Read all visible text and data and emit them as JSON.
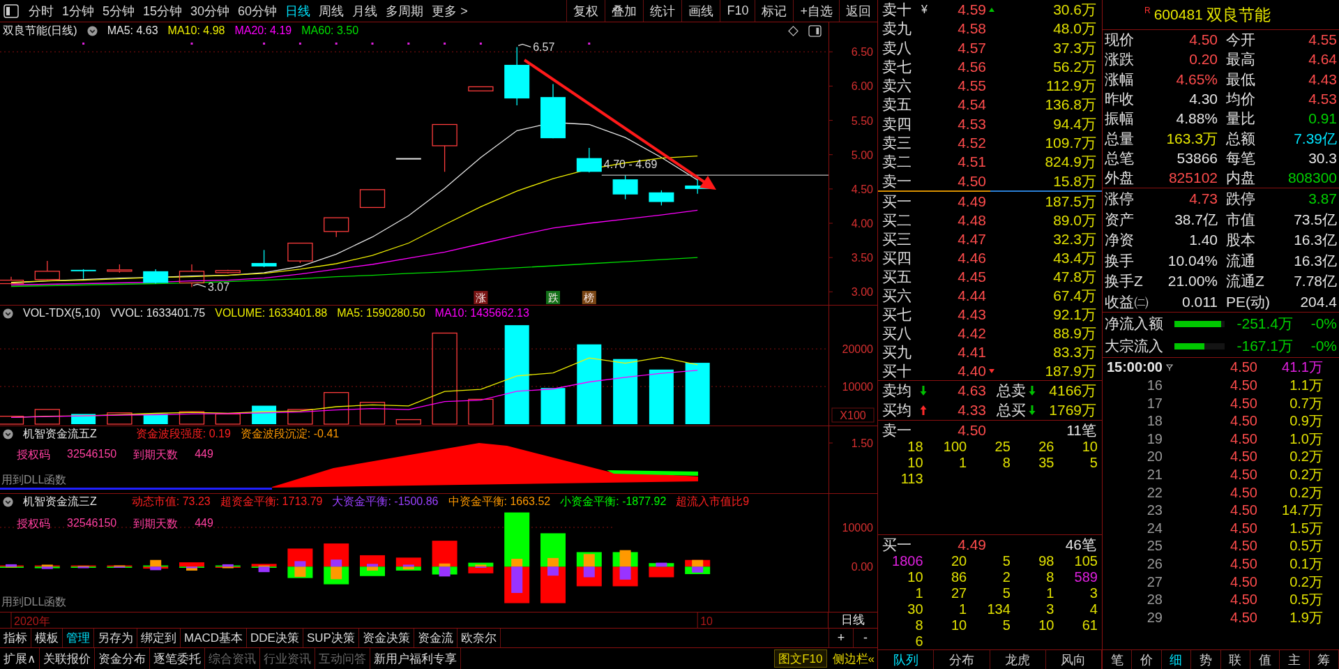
{
  "toolbar": {
    "periods": [
      {
        "label": "分时",
        "selected": false
      },
      {
        "label": "1分钟",
        "selected": false
      },
      {
        "label": "5分钟",
        "selected": false
      },
      {
        "label": "15分钟",
        "selected": false
      },
      {
        "label": "30分钟",
        "selected": false
      },
      {
        "label": "60分钟",
        "selected": false
      },
      {
        "label": "日线",
        "selected": true
      },
      {
        "label": "周线",
        "selected": false
      },
      {
        "label": "月线",
        "selected": false
      },
      {
        "label": "多周期",
        "selected": false
      },
      {
        "label": "更多 >",
        "selected": false
      }
    ],
    "buttons": [
      "复权",
      "叠加",
      "统计",
      "画线",
      "F10",
      "标记",
      "+自选",
      "返回"
    ]
  },
  "price_pane": {
    "title": "双良节能(日线)",
    "legend": [
      {
        "text": "MA5: 4.63",
        "color": "#e6e6e6"
      },
      {
        "text": "MA10: 4.98",
        "color": "#f0f000"
      },
      {
        "text": "MA20: 4.19",
        "color": "#ff00ff"
      },
      {
        "text": "MA60: 3.50",
        "color": "#00e000"
      }
    ],
    "axis_labels": [
      "6.50",
      "6.00",
      "5.50",
      "5.00",
      "4.50",
      "4.00",
      "3.50",
      "3.00"
    ],
    "callouts": [
      "6.57",
      "3.07"
    ],
    "range_label": "4.70 - 4.69",
    "tags": [
      {
        "text": "涨",
        "color": "#7a1414"
      },
      {
        "text": "跌",
        "color": "#127018"
      },
      {
        "text": "榜",
        "color": "#7a4614"
      }
    ]
  },
  "volume_pane": {
    "title": "VOL-TDX(5,10)",
    "readings": [
      {
        "text": "VVOL: 1633401.75",
        "color": "#e6e6e6"
      },
      {
        "text": "VOLUME: 1633401.88",
        "color": "#f0f000"
      },
      {
        "text": "MA5: 1590280.50",
        "color": "#f0f000"
      },
      {
        "text": "MA10: 1435662.13",
        "color": "#ff00ff"
      }
    ],
    "axis_labels": [
      "20000",
      "10000"
    ],
    "unit": "X100"
  },
  "flow5_pane": {
    "title": "机智资金流五Z",
    "readings": [
      {
        "text": "资金波段强度: 0.19",
        "color": "#ff2020"
      },
      {
        "text": "资金波段沉淀: -0.41",
        "color": "#ff9900"
      }
    ],
    "license": [
      "授权码",
      "32546150",
      "到期天数",
      "449"
    ],
    "axis_labels": [
      "1.50"
    ],
    "note": "用到DLL函数"
  },
  "flow3_pane": {
    "title": "机智资金流三Z",
    "readings": [
      {
        "text": "动态市值: 73.23",
        "color": "#ff2020"
      },
      {
        "text": "超资金平衡: 1713.79",
        "color": "#ff2020"
      },
      {
        "text": "大资金平衡: -1500.86",
        "color": "#9a40ff"
      },
      {
        "text": "中资金平衡: 1663.52",
        "color": "#ff9900"
      },
      {
        "text": "小资金平衡: -1877.92",
        "color": "#00ff00"
      },
      {
        "text": "超流入市值比9",
        "color": "#ff2020"
      }
    ],
    "license": [
      "授权码",
      "32546150",
      "到期天数",
      "449"
    ],
    "axis_labels": [
      "10000",
      "0.00"
    ],
    "note": "用到DLL函数"
  },
  "date_axis": {
    "labels": [
      "2020年",
      "10"
    ],
    "period": "日线"
  },
  "tool_tabs": {
    "items": [
      {
        "label": "指标",
        "selected": false
      },
      {
        "label": "模板",
        "selected": false
      },
      {
        "label": "管理",
        "selected": true
      },
      {
        "label": "另存为",
        "selected": false
      },
      {
        "label": "绑定到",
        "selected": false
      },
      {
        "label": "MACD基本",
        "selected": false
      },
      {
        "label": "DDE决策",
        "selected": false
      },
      {
        "label": "SUP决策",
        "selected": false
      },
      {
        "label": "资金决策",
        "selected": false
      },
      {
        "label": "资金流",
        "selected": false
      },
      {
        "label": "欧奈尔",
        "selected": false
      }
    ],
    "zoom_buttons": [
      "+",
      "-"
    ]
  },
  "info_tabs": {
    "items": [
      {
        "label": "扩展∧",
        "disabled": false
      },
      {
        "label": "关联报价",
        "disabled": false
      },
      {
        "label": "资金分布",
        "disabled": false
      },
      {
        "label": "逐笔委托",
        "disabled": false
      },
      {
        "label": "综合资讯",
        "disabled": true
      },
      {
        "label": "行业资讯",
        "disabled": true
      },
      {
        "label": "互动问答",
        "disabled": true
      },
      {
        "label": "新用户福利专享",
        "disabled": false
      }
    ],
    "extras": [
      {
        "label": "图文F10",
        "kind": "boxed"
      },
      {
        "label": "侧边栏«",
        "kind": "plain"
      }
    ]
  },
  "order_book": {
    "asks": [
      {
        "label": "卖十",
        "mark": "¥",
        "price": "4.59",
        "more": true,
        "volume": "30.6万"
      },
      {
        "label": "卖九",
        "price": "4.58",
        "more": false,
        "volume": "48.0万"
      },
      {
        "label": "卖八",
        "price": "4.57",
        "more": false,
        "volume": "37.3万"
      },
      {
        "label": "卖七",
        "price": "4.56",
        "more": false,
        "volume": "56.2万"
      },
      {
        "label": "卖六",
        "price": "4.55",
        "more": false,
        "volume": "112.9万"
      },
      {
        "label": "卖五",
        "price": "4.54",
        "more": false,
        "volume": "136.8万"
      },
      {
        "label": "卖四",
        "price": "4.53",
        "more": false,
        "volume": "94.4万"
      },
      {
        "label": "卖三",
        "price": "4.52",
        "more": false,
        "volume": "109.7万"
      },
      {
        "label": "卖二",
        "price": "4.51",
        "more": false,
        "volume": "824.9万"
      },
      {
        "label": "卖一",
        "price": "4.50",
        "more": false,
        "volume": "15.8万"
      }
    ],
    "bids": [
      {
        "label": "买一",
        "price": "4.49",
        "more": false,
        "volume": "187.5万"
      },
      {
        "label": "买二",
        "price": "4.48",
        "more": false,
        "volume": "89.0万"
      },
      {
        "label": "买三",
        "price": "4.47",
        "more": false,
        "volume": "32.3万"
      },
      {
        "label": "买四",
        "price": "4.46",
        "more": false,
        "volume": "43.4万"
      },
      {
        "label": "买五",
        "price": "4.45",
        "more": false,
        "volume": "47.8万"
      },
      {
        "label": "买六",
        "price": "4.44",
        "more": false,
        "volume": "67.4万"
      },
      {
        "label": "买七",
        "price": "4.43",
        "more": false,
        "volume": "92.1万"
      },
      {
        "label": "买八",
        "price": "4.42",
        "more": false,
        "volume": "88.9万"
      },
      {
        "label": "买九",
        "price": "4.41",
        "more": false,
        "volume": "83.3万"
      },
      {
        "label": "买十",
        "price": "4.40",
        "more": true,
        "volume": "187.9万"
      }
    ],
    "averages": [
      {
        "label": "卖均",
        "rising": false,
        "price": "4.63",
        "total_label": "总卖",
        "total_rising": false,
        "total": "4166万"
      },
      {
        "label": "买均",
        "rising": true,
        "price": "4.33",
        "total_label": "总买",
        "total_rising": false,
        "total": "1769万"
      }
    ],
    "queues": [
      {
        "label": "卖一",
        "price": "4.50",
        "count": "11笔",
        "rows": [
          [
            {
              "text": "18",
              "large": false
            },
            {
              "text": "100",
              "large": false
            },
            {
              "text": "25",
              "large": false
            },
            {
              "text": "26",
              "large": false
            },
            {
              "text": "10",
              "large": false
            }
          ],
          [
            {
              "text": "10",
              "large": false
            },
            {
              "text": "1",
              "large": false
            },
            {
              "text": "8",
              "large": false
            },
            {
              "text": "35",
              "large": false
            },
            {
              "text": "5",
              "large": false
            }
          ],
          [
            {
              "text": "113",
              "large": false
            }
          ]
        ]
      },
      {
        "label": "买一",
        "price": "4.49",
        "count": "46笔",
        "rows": [
          [
            {
              "text": "1806",
              "large": true
            },
            {
              "text": "20",
              "large": false
            },
            {
              "text": "5",
              "large": false
            },
            {
              "text": "98",
              "large": false
            },
            {
              "text": "105",
              "large": false
            }
          ],
          [
            {
              "text": "10",
              "large": false
            },
            {
              "text": "86",
              "large": false
            },
            {
              "text": "2",
              "large": false
            },
            {
              "text": "8",
              "large": false
            },
            {
              "text": "589",
              "large": true
            }
          ],
          [
            {
              "text": "1",
              "large": false
            },
            {
              "text": "27",
              "large": false
            },
            {
              "text": "5",
              "large": false
            },
            {
              "text": "1",
              "large": false
            },
            {
              "text": "3",
              "large": false
            }
          ],
          [
            {
              "text": "30",
              "large": false
            },
            {
              "text": "1",
              "large": false
            },
            {
              "text": "134",
              "large": false
            },
            {
              "text": "3",
              "large": false
            },
            {
              "text": "4",
              "large": false
            }
          ],
          [
            {
              "text": "8",
              "large": false
            },
            {
              "text": "10",
              "large": false
            },
            {
              "text": "5",
              "large": false
            },
            {
              "text": "10",
              "large": false
            },
            {
              "text": "61",
              "large": false
            }
          ],
          [
            {
              "text": "6",
              "large": false
            }
          ]
        ]
      }
    ],
    "tabs": [
      {
        "label": "队列",
        "selected": true
      },
      {
        "label": "分布",
        "selected": false
      },
      {
        "label": "龙虎",
        "selected": false
      },
      {
        "label": "风向",
        "selected": false
      }
    ]
  },
  "quote": {
    "mark": "R",
    "code": "600481",
    "name": "双良节能",
    "groups": [
      [
        [
          {
            "label": "现价",
            "value": "4.50",
            "color": "#ff4c4c"
          },
          {
            "label": "今开",
            "value": "4.55",
            "color": "#ff4c4c"
          }
        ],
        [
          {
            "label": "涨跌",
            "value": "0.20",
            "color": "#ff4c4c"
          },
          {
            "label": "最高",
            "value": "4.64",
            "color": "#ff4c4c"
          }
        ],
        [
          {
            "label": "涨幅",
            "value": "4.65%",
            "color": "#ff4c4c"
          },
          {
            "label": "最低",
            "value": "4.43",
            "color": "#ff4c4c"
          }
        ],
        [
          {
            "label": "昨收",
            "value": "4.30",
            "color": "#e6e6e6"
          },
          {
            "label": "均价",
            "value": "4.53",
            "color": "#ff4c4c"
          }
        ],
        [
          {
            "label": "振幅",
            "value": "4.88%",
            "color": "#e6e6e6"
          },
          {
            "label": "量比",
            "value": "0.91",
            "color": "#00d200"
          }
        ],
        [
          {
            "label": "总量",
            "value": "163.3万",
            "color": "#e6e600"
          },
          {
            "label": "总额",
            "value": "7.39亿",
            "color": "#00e5ff"
          }
        ],
        [
          {
            "label": "总笔",
            "value": "53866",
            "color": "#e6e6e6"
          },
          {
            "label": "每笔",
            "value": "30.3",
            "color": "#e6e6e6"
          }
        ],
        [
          {
            "label": "外盘",
            "value": "825102",
            "color": "#ff4c4c"
          },
          {
            "label": "内盘",
            "value": "808300",
            "color": "#00d200"
          }
        ]
      ],
      [
        [
          {
            "label": "涨停",
            "value": "4.73",
            "color": "#ff4c4c"
          },
          {
            "label": "跌停",
            "value": "3.87",
            "color": "#00d200"
          }
        ],
        [
          {
            "label": "资产",
            "value": "38.7亿",
            "color": "#e6e6e6"
          },
          {
            "label": "市值",
            "value": "73.5亿",
            "color": "#e6e6e6"
          }
        ],
        [
          {
            "label": "净资",
            "value": "1.40",
            "color": "#e6e6e6"
          },
          {
            "label": "股本",
            "value": "16.3亿",
            "color": "#e6e6e6"
          }
        ],
        [
          {
            "label": "换手",
            "value": "10.04%",
            "color": "#e6e6e6"
          },
          {
            "label": "流通",
            "value": "16.3亿",
            "color": "#e6e6e6"
          }
        ],
        [
          {
            "label": "换手Z",
            "value": "21.00%",
            "color": "#e6e6e6"
          },
          {
            "label": "流通Z",
            "value": "7.78亿",
            "color": "#e6e6e6"
          }
        ],
        [
          {
            "label": "收益㈡",
            "value": "0.011",
            "color": "#e6e6e6"
          },
          {
            "label": "PE(动)",
            "value": "204.4",
            "color": "#e6e6e6"
          }
        ]
      ]
    ],
    "flows": [
      {
        "label": "净流入额",
        "level": 0.93,
        "value": "-251.4万",
        "percent": "-0%"
      },
      {
        "label": "大宗流入",
        "level": 0.6,
        "value": "-167.1万",
        "percent": "-0%"
      }
    ],
    "trades": [
      {
        "kind": "full",
        "time": "15:00:00",
        "price": "4.50",
        "volume": "41.1万",
        "color": "#e020e0"
      },
      {
        "kind": "minute",
        "time": "16",
        "price": "4.50",
        "volume": "1.1万",
        "color": "#e0e000"
      },
      {
        "kind": "minute",
        "time": "17",
        "price": "4.50",
        "volume": "0.7万",
        "color": "#e0e000"
      },
      {
        "kind": "minute",
        "time": "18",
        "price": "4.50",
        "volume": "0.9万",
        "color": "#e0e000"
      },
      {
        "kind": "minute",
        "time": "19",
        "price": "4.50",
        "volume": "1.0万",
        "color": "#e0e000"
      },
      {
        "kind": "minute",
        "time": "20",
        "price": "4.50",
        "volume": "0.2万",
        "color": "#e0e000"
      },
      {
        "kind": "minute",
        "time": "21",
        "price": "4.50",
        "volume": "0.2万",
        "color": "#e0e000"
      },
      {
        "kind": "minute",
        "time": "22",
        "price": "4.50",
        "volume": "0.2万",
        "color": "#e0e000"
      },
      {
        "kind": "minute",
        "time": "23",
        "price": "4.50",
        "volume": "14.7万",
        "color": "#e0e000"
      },
      {
        "kind": "minute",
        "time": "24",
        "price": "4.50",
        "volume": "1.5万",
        "color": "#e0e000"
      },
      {
        "kind": "minute",
        "time": "25",
        "price": "4.50",
        "volume": "0.5万",
        "color": "#e0e000"
      },
      {
        "kind": "minute",
        "time": "26",
        "price": "4.50",
        "volume": "0.1万",
        "color": "#e0e000"
      },
      {
        "kind": "minute",
        "time": "27",
        "price": "4.50",
        "volume": "0.2万",
        "color": "#e0e000"
      },
      {
        "kind": "minute",
        "time": "28",
        "price": "4.50",
        "volume": "0.5万",
        "color": "#e0e000"
      },
      {
        "kind": "minute",
        "time": "29",
        "price": "4.50",
        "volume": "1.9万",
        "color": "#e0e000"
      }
    ],
    "tabs": [
      {
        "label": "笔",
        "selected": false
      },
      {
        "label": "价",
        "selected": false
      },
      {
        "label": "细",
        "selected": true
      },
      {
        "label": "势",
        "selected": false
      },
      {
        "label": "联",
        "selected": false
      },
      {
        "label": "值",
        "selected": false
      },
      {
        "label": "主",
        "selected": false
      },
      {
        "label": "筹",
        "selected": false
      }
    ]
  }
}
